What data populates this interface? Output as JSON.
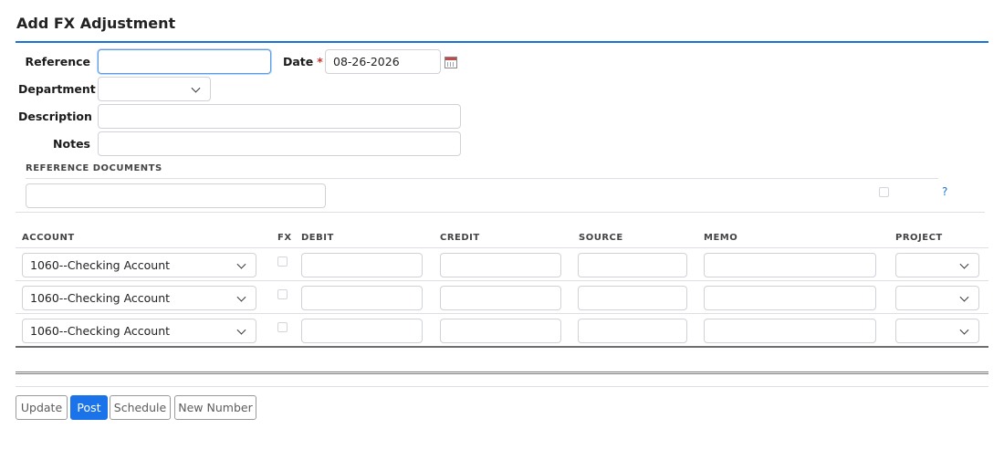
{
  "page": {
    "title": "Add FX Adjustment"
  },
  "form": {
    "reference_label": "Reference",
    "reference_value": "",
    "date_label": "Date",
    "date_required": "*",
    "date_value": "08-26-2026",
    "department_label": "Department",
    "department_value": "",
    "description_label": "Description",
    "description_value": "",
    "notes_label": "Notes",
    "notes_value": ""
  },
  "reference_documents": {
    "heading": "REFERENCE DOCUMENTS",
    "value": "",
    "help": "?"
  },
  "table": {
    "columns": [
      "ACCOUNT",
      "FX",
      "DEBIT",
      "CREDIT",
      "SOURCE",
      "MEMO",
      "PROJECT"
    ],
    "rows": [
      {
        "account": "1060--Checking Account",
        "fx": false,
        "debit": "",
        "credit": "",
        "source": "",
        "memo": "",
        "project": ""
      },
      {
        "account": "1060--Checking Account",
        "fx": false,
        "debit": "",
        "credit": "",
        "source": "",
        "memo": "",
        "project": ""
      },
      {
        "account": "1060--Checking Account",
        "fx": false,
        "debit": "",
        "credit": "",
        "source": "",
        "memo": "",
        "project": ""
      }
    ]
  },
  "actions": {
    "update": "Update",
    "post": "Post",
    "schedule": "Schedule",
    "new_number": "New Number"
  },
  "colors": {
    "accent": "#1a73d9",
    "primary_button": "#1a73e8",
    "required": "#d0342c"
  },
  "icons": {
    "calendar": "calendar-icon",
    "dropdown": "chevron-down-icon"
  }
}
